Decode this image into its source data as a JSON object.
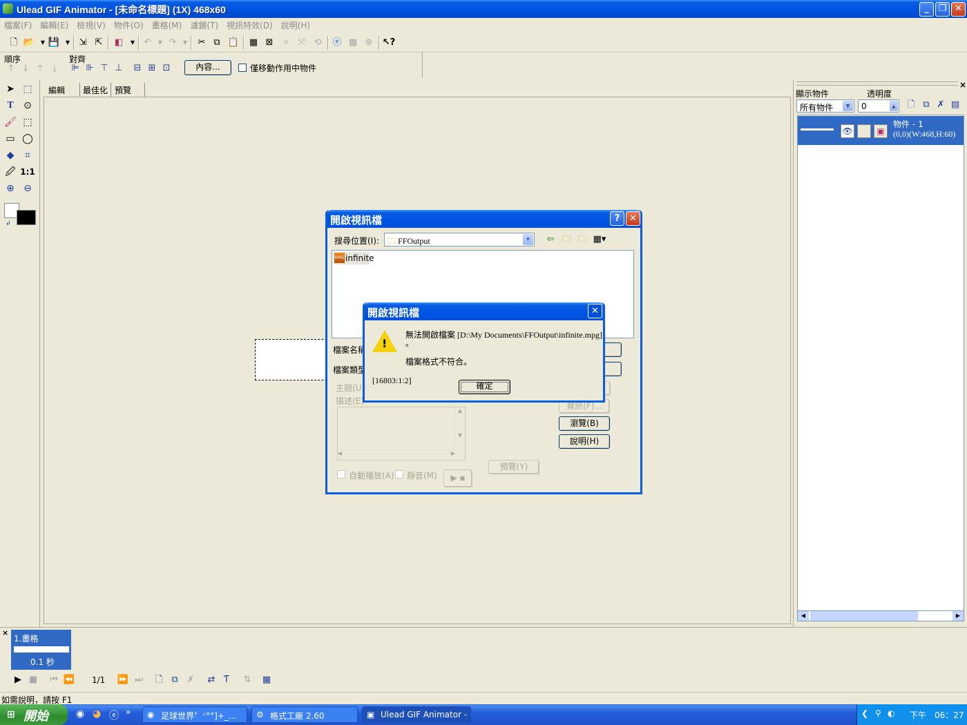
{
  "window": {
    "title": "Ulead GIF Animator - [未命名標題] (1X) 468x60"
  },
  "menu": [
    "檔案(F)",
    "編輯(E)",
    "檢視(V)",
    "物件(O)",
    "畫格(M)",
    "濾鏡(T)",
    "視訊特效(D)",
    "說明(H)"
  ],
  "propbar": {
    "order_label": "順序",
    "align_label": "對齊",
    "content_button": "內容...",
    "move_only_label": "僅移動作用中物件"
  },
  "tabs": [
    "編輯",
    "最佳化",
    "預覽"
  ],
  "rightpanel": {
    "show_label": "顯示物件",
    "opacity_label": "透明度",
    "show_value": "所有物件",
    "opacity_value": "0",
    "object_name": "物件 - 1",
    "object_info": "(0,0)(W:468,H:60)"
  },
  "frames": {
    "frame_label": "1.畫格",
    "frame_delay": "0.1 秒",
    "counter": "1/1"
  },
  "status": "如需說明，請按 F1",
  "taskbar": {
    "start": "開始",
    "tasks": [
      "足球世界〞ᐟ°°]+_...",
      "格式工廠 2.60",
      "Ulead GIF Animator - ..."
    ],
    "time": "下午　06：27"
  },
  "open_dialog": {
    "title": "開啟視訊檔",
    "lookin_label": "搜尋位置(I):",
    "lookin_value": "FFOutput",
    "file_item": "infinite",
    "filename_label": "檔案名稱",
    "filetype_label": "檔案類型",
    "subject_label": "主題(U)",
    "desc_label": "描述(E)",
    "info_button": "資訊(F)...",
    "browse_button": "瀏覽(B)",
    "help_button": "說明(H)",
    "preview_button": "預覽(Y)",
    "autoplay_label": "自動播放(A)",
    "mute_label": "靜音(M)"
  },
  "error_dialog": {
    "title": "開啟視訊檔",
    "message_line1": "無法開啟檔案 [D:\\My Documents\\FFOutput\\infinite.mpg]",
    "message_line1b": "。",
    "message_line2": "檔案格式不符合。",
    "code": "[16803:1:2]",
    "ok_button": "確定"
  }
}
